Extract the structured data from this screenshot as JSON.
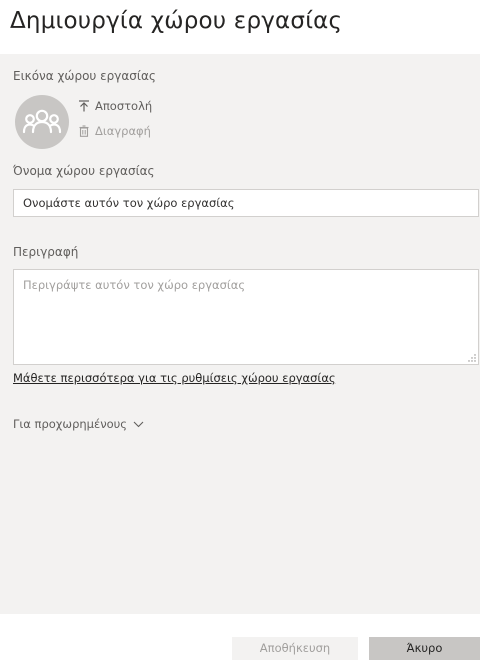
{
  "dialog": {
    "title": "Δημιουργία χώρου εργασίας"
  },
  "workspace_image": {
    "label": "Εικόνα χώρου εργασίας",
    "avatar_icon": "people-group-icon",
    "upload_label": "Αποστολή",
    "upload_icon": "upload-icon",
    "delete_label": "Διαγραφή",
    "delete_icon": "trash-icon"
  },
  "workspace_name": {
    "label": "Όνομα χώρου εργασίας",
    "value": "Ονομάστε αυτόν τον χώρο εργασίας"
  },
  "description": {
    "label": "Περιγραφή",
    "placeholder": "Περιγράψτε αυτόν τον χώρο εργασίας"
  },
  "learn_more_link": "Μάθετε περισσότερα για τις ρυθμίσεις χώρου εργασίας",
  "advanced": {
    "label": "Για προχωρημένους",
    "icon": "chevron-down-icon"
  },
  "footer": {
    "save_label": "Αποθήκευση",
    "cancel_label": "Άκυρο"
  },
  "colors": {
    "panel_background": "#f3f2f1",
    "primary_text": "#252423",
    "secondary_text": "#605e5c",
    "disabled_text": "#a19f9d",
    "avatar_background": "#c8c6c4"
  }
}
